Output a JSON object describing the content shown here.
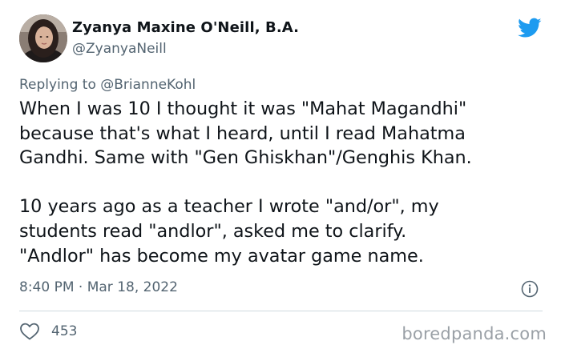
{
  "author": {
    "name": "Zyanya Maxine O'Neill, B.A.",
    "handle": "@ZyanyaNeill"
  },
  "reply": {
    "prefix": "Replying to ",
    "mention": "@BrianneKohl"
  },
  "tweet": {
    "lines": [
      "When I was 10 I thought it was \"Mahat Magandhi\"",
      "because that's what I heard, until I read Mahatma",
      "Gandhi. Same with \"Gen Ghiskhan\"/Genghis Khan.",
      "10 years ago as a teacher I wrote \"and/or\", my",
      "students read \"andlor\", asked me to clarify.",
      "\"Andlor\" has become my avatar game name."
    ]
  },
  "meta": {
    "time": "8:40 PM",
    "separator": " · ",
    "date": "Mar 18, 2022"
  },
  "stats": {
    "likes": "453"
  },
  "watermark": "boredpanda.com",
  "colors": {
    "twitter_blue": "#1d9bf0",
    "text_primary": "#0f1419",
    "text_secondary": "#536471",
    "divider": "#cfd9de"
  },
  "icons": {
    "logo": "twitter-bird-icon",
    "info": "info-icon",
    "like": "heart-icon"
  }
}
